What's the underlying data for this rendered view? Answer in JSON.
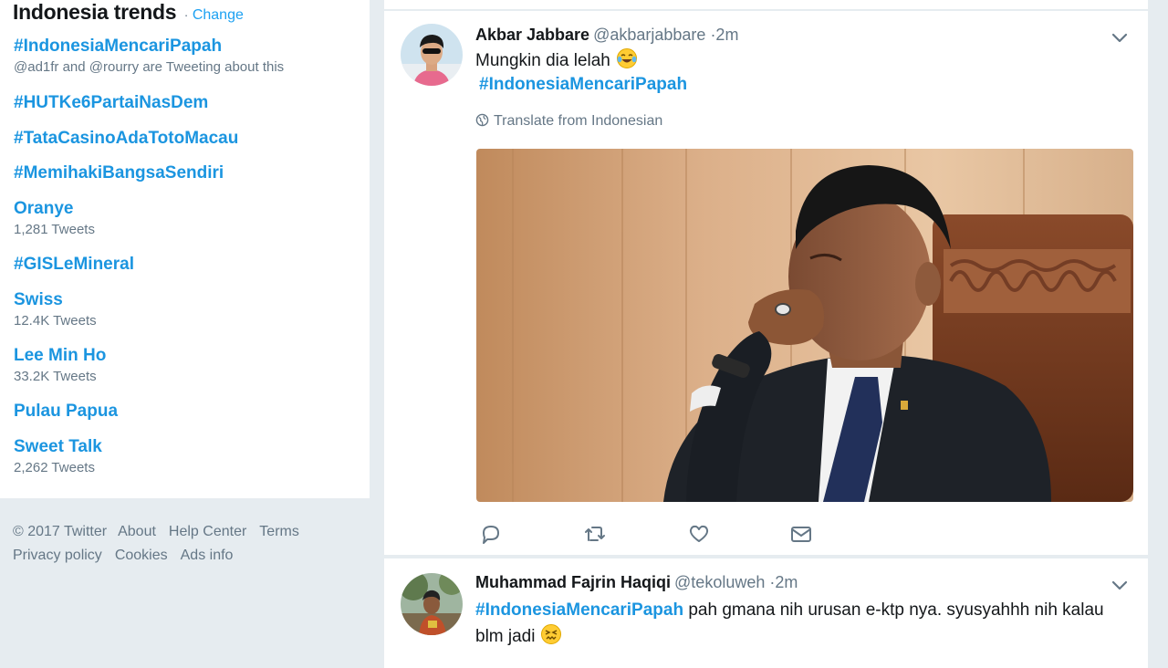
{
  "trends": {
    "title": "Indonesia trends",
    "separator": "·",
    "change_label": "Change",
    "items": [
      {
        "name": "#IndonesiaMencariPapah",
        "meta": "@ad1fr and @rourry are Tweeting about this"
      },
      {
        "name": "#HUTKe6PartaiNasDem",
        "meta": ""
      },
      {
        "name": "#TataCasinoAdaTotoMacau",
        "meta": ""
      },
      {
        "name": "#MemihakiBangsaSendiri",
        "meta": ""
      },
      {
        "name": "Oranye",
        "meta": "1,281 Tweets"
      },
      {
        "name": "#GISLeMineral",
        "meta": ""
      },
      {
        "name": "Swiss",
        "meta": "12.4K Tweets"
      },
      {
        "name": "Lee Min Ho",
        "meta": "33.2K Tweets"
      },
      {
        "name": "Pulau Papua",
        "meta": ""
      },
      {
        "name": "Sweet Talk",
        "meta": "2,262 Tweets"
      }
    ]
  },
  "footer": {
    "copyright": "© 2017 Twitter",
    "links": [
      "About",
      "Help Center",
      "Terms",
      "Privacy policy",
      "Cookies",
      "Ads info"
    ]
  },
  "tweets": [
    {
      "fullname": "Akbar Jabbare",
      "username": "@akbarjabbare",
      "time": "·2m",
      "text": "Mungkin dia lelah",
      "emoji": "face-with-tears-of-joy",
      "hashtag": "#IndonesiaMencariPapah",
      "translate_label": "Translate from Indonesian",
      "media": "photo-man-yawning-in-leather-chair"
    },
    {
      "fullname": "Muhammad Fajrin Haqiqi",
      "username": "@tekoluweh",
      "time": "·2m",
      "hashtag": "#IndonesiaMencariPapah",
      "text": " pah gmana nih urusan e-ktp nya. syusyahhh nih kalau blm jadi",
      "emoji": "persevering-face"
    }
  ],
  "colors": {
    "accent": "#1da1f2",
    "link": "#1b95e0",
    "muted": "#657786",
    "background": "#e6ecf0"
  }
}
